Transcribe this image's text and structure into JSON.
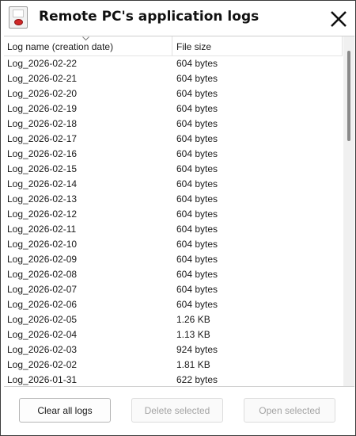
{
  "window": {
    "title": "Remote PC's application logs"
  },
  "table": {
    "columns": [
      "Log name (creation date)",
      "File size"
    ],
    "sort_column": "Log name (creation date)",
    "rows": [
      {
        "name": "Log_2026-02-22",
        "size": "604 bytes"
      },
      {
        "name": "Log_2026-02-21",
        "size": "604 bytes"
      },
      {
        "name": "Log_2026-02-20",
        "size": "604 bytes"
      },
      {
        "name": "Log_2026-02-19",
        "size": "604 bytes"
      },
      {
        "name": "Log_2026-02-18",
        "size": "604 bytes"
      },
      {
        "name": "Log_2026-02-17",
        "size": "604 bytes"
      },
      {
        "name": "Log_2026-02-16",
        "size": "604 bytes"
      },
      {
        "name": "Log_2026-02-15",
        "size": "604 bytes"
      },
      {
        "name": "Log_2026-02-14",
        "size": "604 bytes"
      },
      {
        "name": "Log_2026-02-13",
        "size": "604 bytes"
      },
      {
        "name": "Log_2026-02-12",
        "size": "604 bytes"
      },
      {
        "name": "Log_2026-02-11",
        "size": "604 bytes"
      },
      {
        "name": "Log_2026-02-10",
        "size": "604 bytes"
      },
      {
        "name": "Log_2026-02-09",
        "size": "604 bytes"
      },
      {
        "name": "Log_2026-02-08",
        "size": "604 bytes"
      },
      {
        "name": "Log_2026-02-07",
        "size": "604 bytes"
      },
      {
        "name": "Log_2026-02-06",
        "size": "604 bytes"
      },
      {
        "name": "Log_2026-02-05",
        "size": "1.26 KB"
      },
      {
        "name": "Log_2026-02-04",
        "size": "1.13 KB"
      },
      {
        "name": "Log_2026-02-03",
        "size": "924 bytes"
      },
      {
        "name": "Log_2026-02-02",
        "size": "1.81 KB"
      },
      {
        "name": "Log_2026-01-31",
        "size": "622 bytes"
      }
    ]
  },
  "buttons": {
    "clear_all": "Clear all logs",
    "delete_selected": "Delete selected",
    "open_selected": "Open selected"
  },
  "icons": {
    "app": "remote-pc-icon",
    "close": "close-icon",
    "sort": "sort-ascending-icon"
  },
  "colors": {
    "app_icon_accent": "#d02828",
    "disabled_text": "#a3a3a3"
  }
}
